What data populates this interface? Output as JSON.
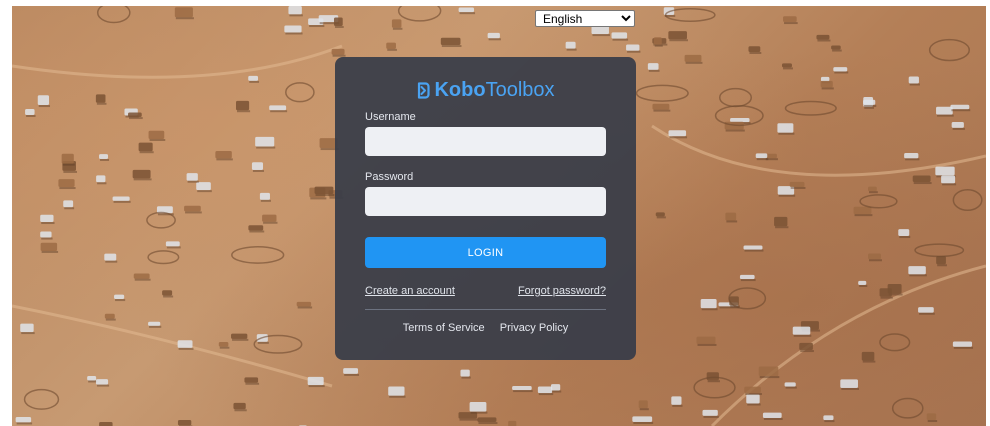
{
  "language_selector": {
    "selected": "English"
  },
  "brand": {
    "name_bold": "Kobo",
    "name_light": "Toolbox",
    "mark_icon": "kobo-logo-icon",
    "color": "#2c95f0"
  },
  "form": {
    "username_label": "Username",
    "username_value": "",
    "password_label": "Password",
    "password_value": "",
    "login_label": "LOGIN"
  },
  "links": {
    "create_account": "Create an account",
    "forgot_password": "Forgot password?"
  },
  "footer": {
    "terms": "Terms of Service",
    "privacy": "Privacy Policy"
  },
  "colors": {
    "accent": "#2095f3",
    "card": "#383c48"
  }
}
